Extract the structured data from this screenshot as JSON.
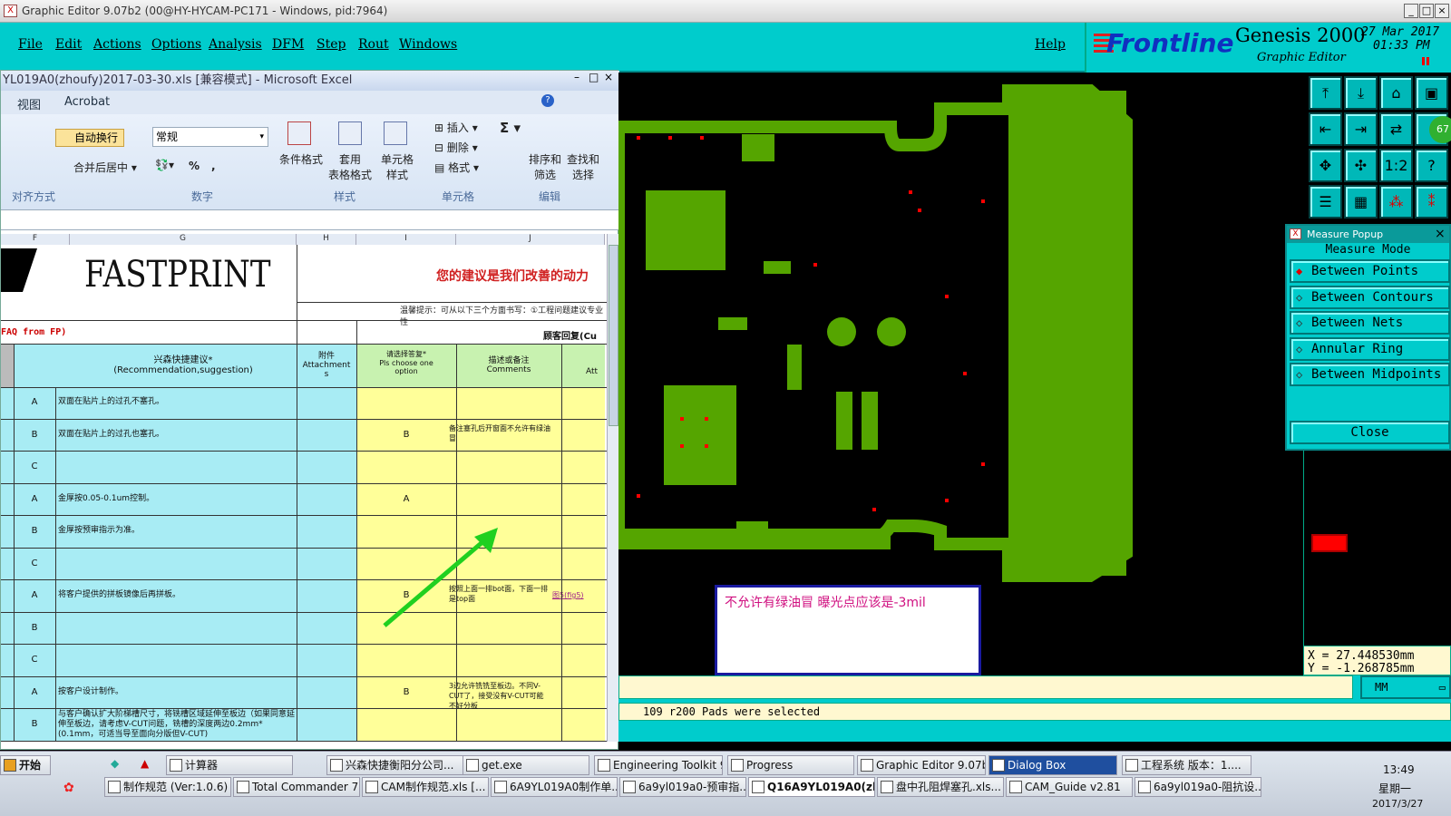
{
  "window": {
    "title": "Graphic Editor 9.07b2 (00@HY-HYCAM-PC171 - Windows, pid:7964)",
    "icon": "x-logo-icon"
  },
  "menu": {
    "items": [
      "File",
      "Edit",
      "Actions",
      "Options",
      "Analysis",
      "DFM",
      "Step",
      "Rout",
      "Windows"
    ],
    "help": "Help"
  },
  "brand": {
    "logo": "Frontline",
    "product": "Genesis 2000",
    "subtitle": "Graphic Editor",
    "date": "27 Mar 2017",
    "time": "01:33 PM"
  },
  "toolbar": {
    "badge": "67",
    "ratio_label": "1:2",
    "help_label": "?"
  },
  "excel": {
    "title": "YL019A0(zhoufy)2017-03-30.xls  [兼容模式] - Microsoft Excel",
    "tabs": [
      "视图",
      "Acrobat"
    ],
    "ribbon": {
      "wrap": "自动换行",
      "merge": "合并后居中",
      "align_group": "对齐方式",
      "number_format": "常规",
      "number_group": "数字",
      "cond_format": "条件格式",
      "table_format": "套用\n表格格式",
      "cell_style": "单元格\n样式",
      "style_group": "样式",
      "insert": "插入",
      "delete": "删除",
      "format": "格式",
      "cells_group": "单元格",
      "sort": "排序和\n筛选",
      "find": "查找和\n选择",
      "edit_group": "编辑",
      "percent": "%",
      "comma": ","
    },
    "columns": [
      "F",
      "G",
      "H",
      "I",
      "J"
    ],
    "company": "FASTPRINT",
    "slogan": "您的建议是我们改善的动力",
    "reminder": "温馨提示：可从以下三个方面书写：①工程问题建议专业性",
    "faq": "FAQ from FP)",
    "customer_reply": "顾客回复(Cu",
    "headers": {
      "rec": "兴森快捷建议*\n(Recommendation,suggestion)",
      "attach": "附件\nAttachment\ns",
      "choose": "请选择答复*\nPls choose one\noption",
      "comments": "描述或备注\nComments",
      "att": "Att"
    },
    "rows": [
      {
        "opt": "A",
        "text": "双面在贴片上的过孔不塞孔。",
        "choice": "",
        "comment": "",
        "link": ""
      },
      {
        "opt": "B",
        "text": "双面在贴片上的过孔也塞孔。",
        "choice": "B",
        "comment": "备注塞孔后开窗面不允许有绿油冒",
        "link": ""
      },
      {
        "opt": "C",
        "text": "",
        "choice": "",
        "comment": "",
        "link": ""
      },
      {
        "opt": "A",
        "text": "金厚按0.05-0.1um控制。",
        "choice": "A",
        "comment": "",
        "link": ""
      },
      {
        "opt": "B",
        "text": "金厚按预审指示为准。",
        "choice": "",
        "comment": "",
        "link": ""
      },
      {
        "opt": "C",
        "text": "",
        "choice": "",
        "comment": "",
        "link": ""
      },
      {
        "opt": "A",
        "text": "将客户提供的拼板镜像后再拼板。",
        "choice": "B",
        "comment": "按照上面一排bot面，下面一排是top面",
        "link": "图5(fig5)"
      },
      {
        "opt": "B",
        "text": "",
        "choice": "",
        "comment": "",
        "link": ""
      },
      {
        "opt": "C",
        "text": "",
        "choice": "",
        "comment": "",
        "link": ""
      },
      {
        "opt": "A",
        "text": "按客户设计制作。",
        "choice": "B",
        "comment": "3边允许铣铣至板边。不同V-CUT了，接受没有V-CUT可能不好分板",
        "link": ""
      },
      {
        "opt": "B",
        "text": "与客户确认扩大阶梯槽尺寸，将铣槽区域延伸至板边（如果同意延伸至板边，请考虑V-CUT问题，铣槽的深度两边0.2mm*(0.1mm，可适当导至面向分版但V-CUT)",
        "choice": "",
        "comment": "",
        "link": ""
      }
    ]
  },
  "annotation": {
    "text": "不允许有绿油冒  曝光点应该是-3mil"
  },
  "measure": {
    "title": "Measure Popup",
    "mode_label": "Measure Mode",
    "modes": [
      "Between Points",
      "Between Contours",
      "Between Nets",
      "Annular Ring",
      "Between Midpoints"
    ],
    "selected": 0,
    "close": "Close"
  },
  "coord": {
    "x": "X = 27.448530mm",
    "y": "Y = -1.268785mm"
  },
  "units": "MM",
  "status": "109 r200 Pads were selected",
  "taskbar": {
    "start": "开始",
    "row1": [
      "计算器",
      "兴森快捷衡阳分公司...",
      "get.exe",
      "Engineering Toolkit 9....",
      "Progress",
      "Graphic Editor 9.07b2 ...",
      "Dialog Box",
      "工程系统  版本：1...."
    ],
    "row2": [
      "制作规范 (Ver:1.0.6)",
      "Total Commander 7.0...",
      "CAM制作规范.xls [...",
      "6A9YL019A0制作单....",
      "6a9yl019a0-预审指...",
      "Q16A9YL019A0(zh...",
      "盘中孔阻焊塞孔.xls...",
      "CAM_Guide v2.81",
      "6a9yl019a0-阻抗设..."
    ],
    "time": "13:49",
    "weekday": "星期一",
    "date": "2017/3/27"
  }
}
